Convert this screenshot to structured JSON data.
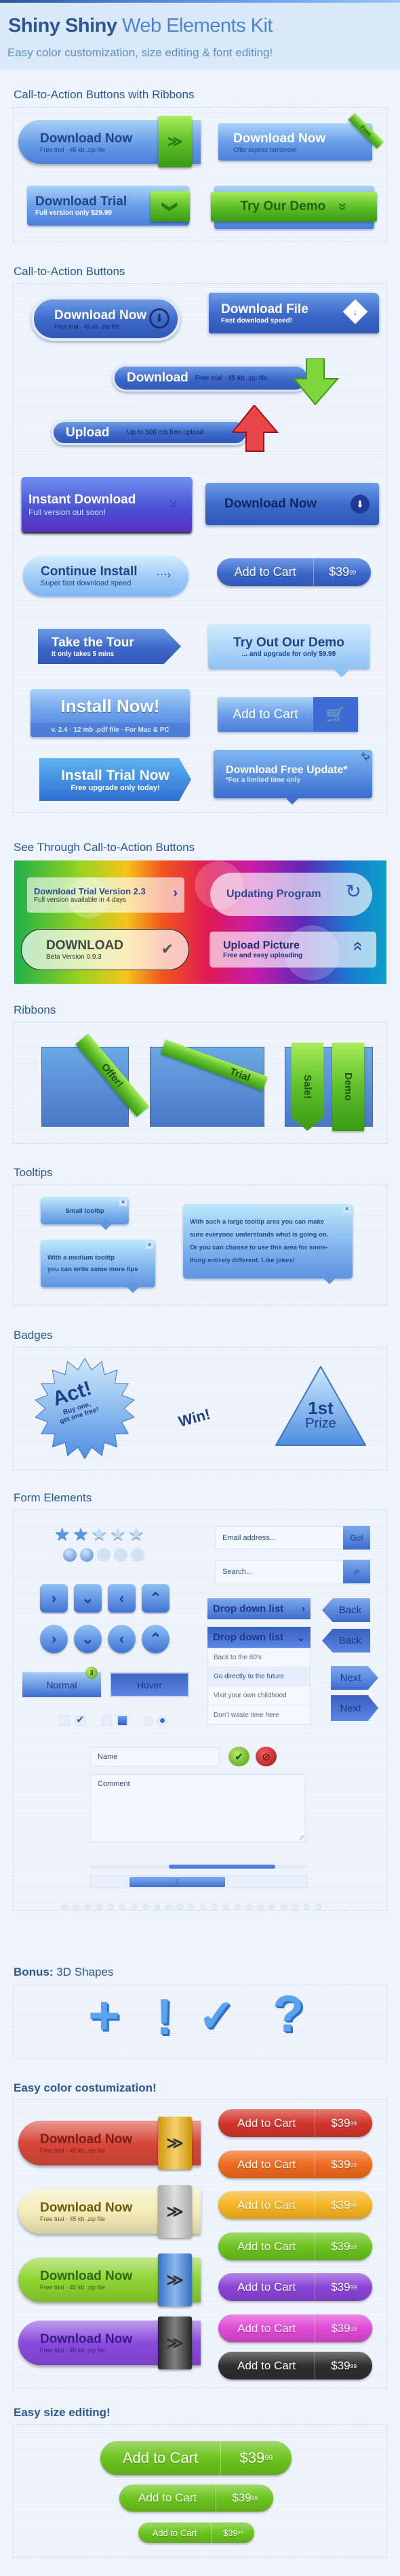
{
  "header": {
    "title_bold": "Shiny Shiny",
    "title_light": "Web Elements Kit",
    "subtitle": "Easy color customization, size editing & font editing!"
  },
  "colors": {
    "title": "#2c5796",
    "accent_blue": "#4b7fdb",
    "ribbon_green": "#5fc02a",
    "background": "#eef4fe"
  },
  "ribbon_buttons": {
    "title": "Call-to-Action Buttons with Ribbons",
    "download_now": {
      "label": "Download Now",
      "sub1": "Free trial",
      "sub2": "45 kb .zip file",
      "icon": "double-chevron-down-icon"
    },
    "download_now_free": {
      "label": "Download Now",
      "sub": "Offer expires tomorrow!",
      "ribbon": "Free"
    },
    "download_trial": {
      "label": "Download Trial",
      "sub": "Full version only $29.99",
      "icon": "chevron-down-icon"
    },
    "try_demo": {
      "label": "Try Our Demo",
      "icon": "double-chevron-down-icon"
    }
  },
  "cta_buttons": {
    "title": "Call-to-Action Buttons",
    "download_now": {
      "label": "Download Now",
      "sub1": "Free trial",
      "sub2": "45 kb .zip file"
    },
    "download_file": {
      "label": "Download File",
      "sub": "Fast download speed!"
    },
    "download_bar": {
      "label": "Download",
      "sub1": "Free trial",
      "sub2": "45 kb .zip file"
    },
    "upload_bar": {
      "label": "Upload",
      "sub": "Up to 500 mb free upload"
    },
    "instant_download": {
      "label": "Instant Download",
      "sub": "Full version out soon!"
    },
    "download_now_2": {
      "label": "Download Now"
    },
    "continue_install": {
      "label": "Continue Install",
      "sub": "Super fast download speed"
    },
    "add_to_cart": {
      "label": "Add to Cart",
      "price": "$39",
      "cents": "99"
    },
    "take_tour": {
      "label": "Take the Tour",
      "sub": "It only takes 5 mins"
    },
    "try_out_demo": {
      "label": "Try Out Our Demo",
      "sub": "... and upgrade for only $9.99"
    },
    "install_now": {
      "label": "Install Now!",
      "sub": "v. 2.4  ·  12 mb .pdf file  ·  For Mac & PC"
    },
    "add_to_cart_2": {
      "label": "Add to Cart",
      "icon": "cart-add-icon"
    },
    "install_trial": {
      "label": "Install Trial Now",
      "sub": "Free upgrade only today!"
    },
    "free_update": {
      "label": "Download Free Update*",
      "sub": "*For a limited time only",
      "corner": "v.2"
    }
  },
  "see_through": {
    "title": "See Through Call-to-Action Buttons",
    "trial": {
      "label": "Download Trial Version 2.3",
      "sub": "Full version available in 4 days"
    },
    "updating": {
      "label": "Updating Program"
    },
    "download": {
      "label": "DOWNLOAD",
      "sub": "Beta Version 0.9.3"
    },
    "upload": {
      "label": "Upload Picture",
      "sub": "Free and easy uploading"
    }
  },
  "ribbons": {
    "title": "Ribbons",
    "items": [
      "Offer!",
      "Trial",
      "Sale!",
      "Demo"
    ]
  },
  "tooltips": {
    "title": "Tooltips",
    "small": "Small tooltip",
    "medium": [
      "With a medium tooltip",
      "you can write some more tips"
    ],
    "large": [
      "With such a large tooltip area you can make",
      "sure everyone understands what is going on.",
      "Or you can choose to use this area for some-",
      "thing entirely different. Like jokes!"
    ],
    "close": "×"
  },
  "badges": {
    "title": "Badges",
    "burst": {
      "main": "Act!",
      "sub1": "Buy one,",
      "sub2": "get one free!"
    },
    "star": "Win!",
    "triangle": {
      "line1": "1st",
      "line2": "Prize"
    }
  },
  "form": {
    "title": "Form Elements",
    "star_rating": {
      "value": 2,
      "max": 5
    },
    "dot_rating": {
      "value": 2,
      "max": 5
    },
    "email_placeholder": "Email address...",
    "go_label": "Go!",
    "search_placeholder": "Search...",
    "dropdown_label": "Drop down list",
    "dropdown_options": [
      "Back to the 80's",
      "Go directly to the future",
      "Visit your own childhood",
      "Don't waste time here"
    ],
    "dropdown_highlighted": 1,
    "back_label": "Back",
    "next_label": "Next",
    "normal_label": "Normal",
    "hover_label": "Hover",
    "notification_count": "3",
    "checkboxes": [
      false,
      true
    ],
    "squares": [
      false,
      true
    ],
    "radios": [
      false,
      true
    ],
    "name_placeholder": "Name",
    "comment_placeholder": "Comment",
    "range_slider_percent": [
      36,
      85
    ],
    "scrollbar_thumb_percent": [
      18,
      62
    ],
    "pagination_dots": 23
  },
  "bonus": {
    "title_bold": "Bonus:",
    "title_rest": "3D Shapes",
    "shapes": [
      "+",
      "!",
      "✓",
      "?"
    ]
  },
  "color_custom": {
    "title": "Easy color costumization!",
    "download": {
      "label": "Download Now",
      "sub1": "Free trial",
      "sub2": "45 kb .zip file"
    },
    "download_variants": [
      {
        "body": "#d9473a",
        "ribbon": "#f2b10c",
        "text": "#7a1d12"
      },
      {
        "body": "#f3ecb8",
        "ribbon": "#c9c9c9",
        "text": "#6b5c10"
      },
      {
        "body": "#8fd432",
        "ribbon": "#3f86e3",
        "text": "#2d6a0c"
      },
      {
        "body": "#8a4ade",
        "ribbon": "#2e2e2e",
        "text": "#3a1a8a"
      }
    ],
    "cart": {
      "label": "Add to Cart",
      "price": "$39",
      "cents": "99"
    },
    "cart_colors": [
      "#d2362c",
      "#f06a1e",
      "#f6b422",
      "#6cc41e",
      "#8a45d8",
      "#e049d5",
      "#2e2e2e"
    ]
  },
  "size_edit": {
    "title": "Easy size editing!",
    "cart": {
      "label": "Add to Cart",
      "price": "$39",
      "cents": "99"
    },
    "color": "#6cc41e"
  }
}
